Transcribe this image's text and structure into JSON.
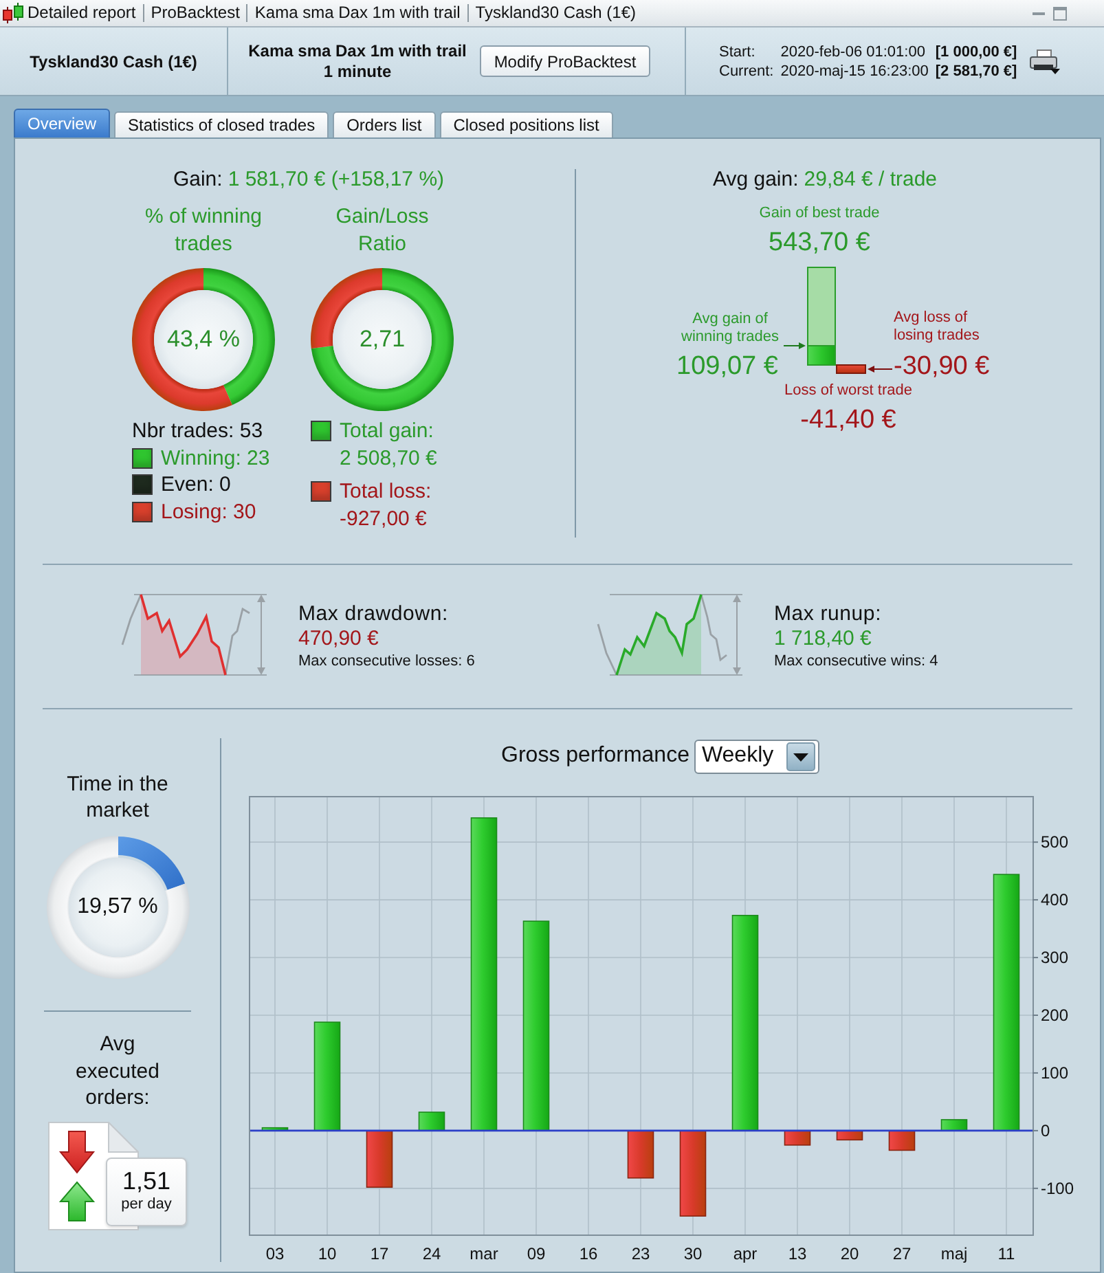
{
  "title_bar": {
    "breadcrumbs": [
      "Detailed report",
      "ProBacktest",
      "Kama sma Dax 1m with trail",
      "Tyskland30 Cash (1€)"
    ]
  },
  "header": {
    "instrument": "Tyskland30 Cash (1€)",
    "strategy": "Kama sma Dax 1m with trail",
    "timeframe": "1 minute",
    "modify_button": "Modify ProBacktest",
    "period": [
      {
        "label": "Start:",
        "date": "2020-feb-06 01:01:00",
        "capital": "[1 000,00 €]"
      },
      {
        "label": "Current:",
        "date": "2020-maj-15 16:23:00",
        "capital": "[2 581,70 €]"
      }
    ]
  },
  "tabs": [
    {
      "label": "Overview",
      "selected": true
    },
    {
      "label": "Statistics of closed trades",
      "selected": false
    },
    {
      "label": "Orders list",
      "selected": false
    },
    {
      "label": "Closed positions list",
      "selected": false
    }
  ],
  "gain": {
    "label": "Gain:",
    "value": "1 581,70 € (+158,17 %)"
  },
  "gauges": [
    {
      "title": "% of winning trades",
      "value": "43,4 %",
      "chart_data": {
        "type": "donut",
        "values": [
          43.4,
          56.6
        ]
      }
    },
    {
      "title": "Gain/Loss Ratio",
      "value": "2,71",
      "chart_data": {
        "type": "donut",
        "values": [
          73.02,
          26.98
        ]
      }
    }
  ],
  "trades_legend": {
    "total": "Nbr trades: 53",
    "items": [
      {
        "label": "Winning: 23",
        "kind": "win",
        "color": "#2fc52f"
      },
      {
        "label": "Even: 0",
        "kind": "even",
        "color": "#1e2a1e"
      },
      {
        "label": "Losing: 30",
        "kind": "loss",
        "color": "#d8402c"
      }
    ]
  },
  "totals_legend": [
    {
      "label": "Total gain:",
      "value": "2 508,70 €",
      "kind": "win",
      "color": "#2fc52f"
    },
    {
      "label": "Total loss:",
      "value": "-927,00 €",
      "kind": "loss",
      "color": "#d8402c"
    }
  ],
  "avg_gain": {
    "label": "Avg gain:",
    "value": "29,84 € / trade"
  },
  "trade_extremes": {
    "best": {
      "caption": "Gain of best trade",
      "value": "543,70 €"
    },
    "avg_win": {
      "caption": "Avg gain of winning trades",
      "value": "109,07 €"
    },
    "avg_loss": {
      "caption": "Avg loss of losing trades",
      "value": "-30,90 €"
    },
    "worst": {
      "caption": "Loss of worst trade",
      "value": "-41,40 €"
    }
  },
  "runs": [
    {
      "kind": "drawdown",
      "title": "Max drawdown:",
      "value": "470,90 €",
      "detail": "Max consecutive losses: 6"
    },
    {
      "kind": "runup",
      "title": "Max runup:",
      "value": "1 718,40 €",
      "detail": "Max consecutive wins: 4"
    }
  ],
  "time_in_market": {
    "title": "Time in the market",
    "value": "19,57 %",
    "chart_data": {
      "type": "donut",
      "values": [
        19.57,
        80.43
      ]
    }
  },
  "executed_orders": {
    "title": "Avg executed orders:",
    "value": "1,51",
    "unit": "per day"
  },
  "performance": {
    "title": "Gross performance",
    "period_select": {
      "value": "Weekly"
    },
    "chart_data": {
      "type": "bar",
      "categories": [
        "03",
        "10",
        "17",
        "24",
        "mar",
        "09",
        "16",
        "23",
        "30",
        "apr",
        "13",
        "20",
        "27",
        "maj",
        "11"
      ],
      "values": [
        5,
        188,
        -98,
        32,
        542,
        363,
        null,
        -82,
        -148,
        373,
        -25,
        -16,
        -34,
        19,
        444
      ],
      "ylim": [
        -180,
        580
      ],
      "yticks": [
        -100,
        0,
        100,
        200,
        300,
        400,
        500
      ],
      "grid": true,
      "ref_lines": [
        {
          "axis": "y",
          "value": 0
        }
      ]
    }
  }
}
